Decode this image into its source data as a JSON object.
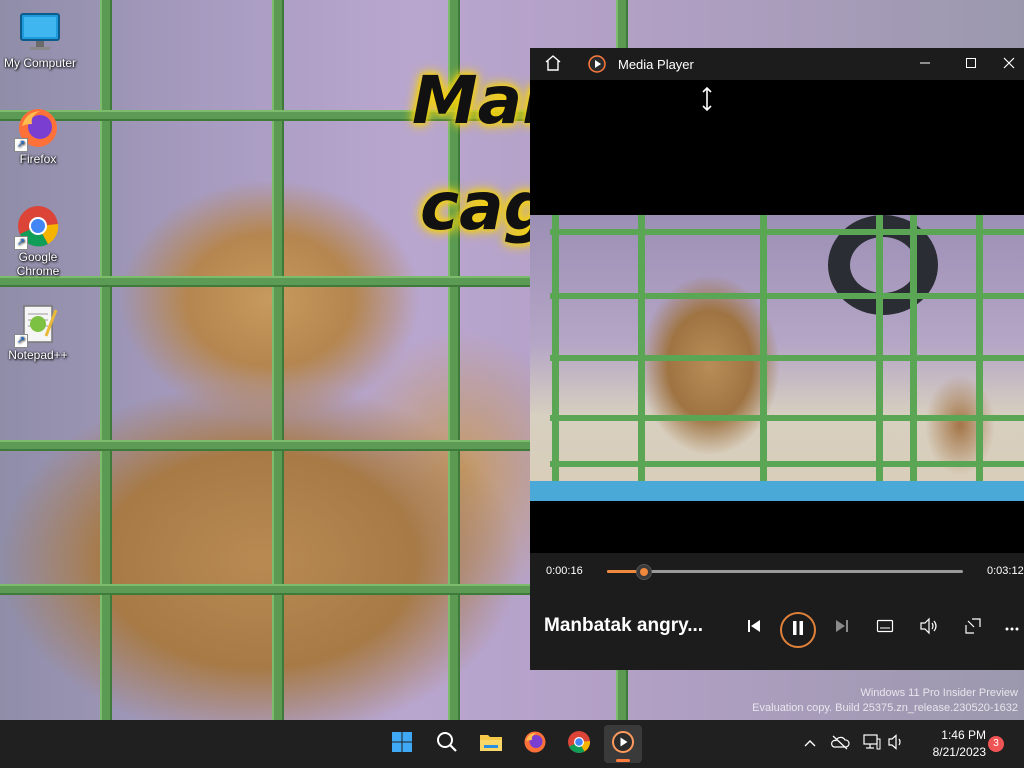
{
  "wallpaper": {
    "caption_line1": "Man",
    "caption_line2": "cage"
  },
  "desktop_icons": [
    {
      "label": "My Computer",
      "icon": "monitor-icon"
    },
    {
      "label": "Firefox",
      "icon": "firefox-icon"
    },
    {
      "label": "Google Chrome",
      "icon": "chrome-icon"
    },
    {
      "label": "Notepad++",
      "icon": "notepadpp-icon"
    }
  ],
  "watermark": {
    "line1": "Windows 11 Pro Insider Preview",
    "line2": "Evaluation copy. Build 25375.zn_release.230520-1632"
  },
  "media_player": {
    "title": "Media Player",
    "elapsed": "0:00:16",
    "duration": "0:03:12",
    "progress": 0.1,
    "now_playing": "Manbatak angry..."
  },
  "taskbar": {
    "apps": [
      "start",
      "search",
      "file-explorer",
      "firefox",
      "chrome",
      "media-player"
    ],
    "time": "1:46 PM",
    "date": "8/21/2023",
    "notification_count": "3"
  },
  "colors": {
    "accent": "#f0883e",
    "taskbar": "#202020",
    "titlebar": "#1c1c1c"
  }
}
